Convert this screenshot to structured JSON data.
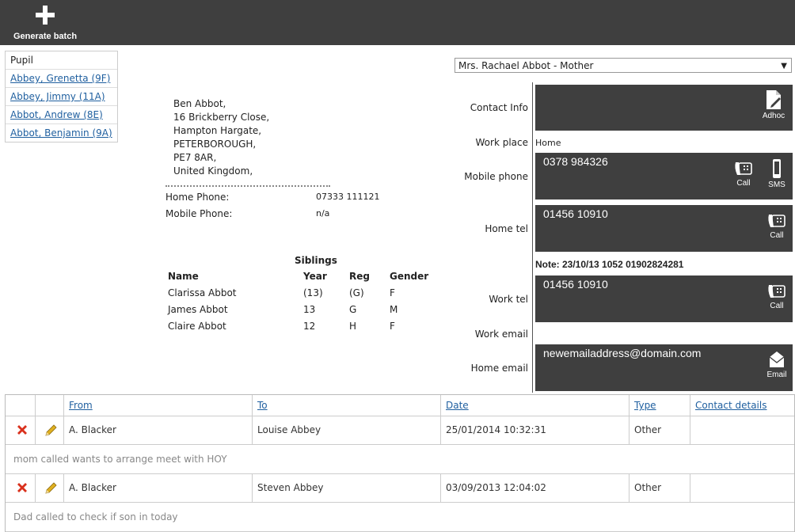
{
  "toolbar": {
    "generate_label": "Generate batch"
  },
  "pupils": {
    "header": "Pupil",
    "items": [
      "Abbey, Grenetta (9F)",
      "Abbey, Jimmy (11A)",
      "Abbot, Andrew (8E)",
      "Abbot, Benjamin (9A)"
    ]
  },
  "address": [
    "Ben Abbot,",
    "16 Brickberry Close,",
    "Hampton Hargate,",
    "PETERBOROUGH,",
    "PE7 8AR,",
    "United Kingdom,"
  ],
  "phones": {
    "home_label": "Home Phone:",
    "home_value": "07333 111121",
    "mobile_label": "Mobile Phone:",
    "mobile_value": "n/a"
  },
  "siblings": {
    "title": "Siblings",
    "headers": [
      "Name",
      "Year",
      "Reg",
      "Gender"
    ],
    "rows": [
      [
        "Clarissa Abbot",
        "(13)",
        "(G)",
        "F"
      ],
      [
        "James Abbot",
        "13",
        "G",
        "M"
      ],
      [
        "Claire Abbot",
        "12",
        "H",
        "F"
      ]
    ]
  },
  "contact": {
    "selected": "Mrs. Rachael Abbot - Mother",
    "labels": {
      "contact_info": "Contact Info",
      "work_place": "Work place",
      "mobile_phone": "Mobile phone",
      "home_tel": "Home tel",
      "work_tel": "Work tel",
      "work_email": "Work email",
      "home_email": "Home email"
    },
    "work_place_value": "Home",
    "mobile_value": "0378 984326",
    "home_tel_value": "01456 10910",
    "note": "Note: 23/10/13 1052 01902824281",
    "work_tel_value": "01456 10910",
    "home_email_value": "newemailaddress@domain.com",
    "actions": {
      "adhoc": "Adhoc",
      "call": "Call",
      "sms": "SMS",
      "email": "Email"
    }
  },
  "log": {
    "headers": [
      "From",
      "To",
      "Date",
      "Type",
      "Contact details"
    ],
    "rows": [
      {
        "from": "A. Blacker",
        "to": "Louise Abbey",
        "date": "25/01/2014 10:32:31",
        "type": "Other",
        "details": "",
        "note": "mom called wants to arrange meet with HOY"
      },
      {
        "from": "A. Blacker",
        "to": "Steven Abbey",
        "date": "03/09/2013 12:04:02",
        "type": "Other",
        "details": "",
        "note": "Dad called to check if son in today"
      }
    ]
  },
  "colors": {
    "dark_panel": "#3f3f3f",
    "link": "#1f5f9f",
    "delete": "#d9301c",
    "edit": "#e0b020"
  }
}
